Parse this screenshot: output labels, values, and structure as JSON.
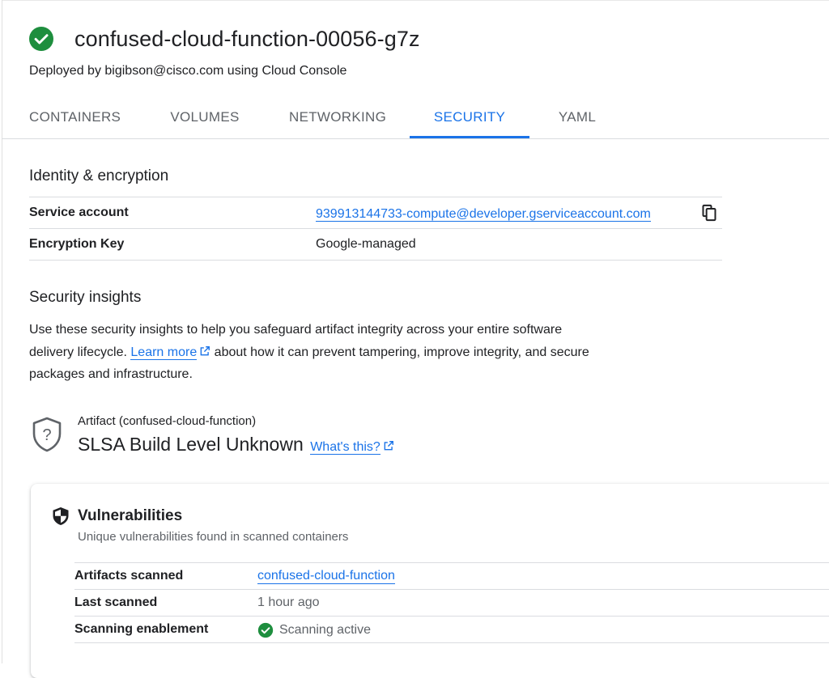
{
  "revision": {
    "name": "confused-cloud-function-00056-g7z",
    "status_icon": "check-circle-icon",
    "status_color": "#1e8e3e",
    "deployed_by": "Deployed by bigibson@cisco.com using Cloud Console"
  },
  "tabs": [
    {
      "label": "CONTAINERS",
      "active": false
    },
    {
      "label": "VOLUMES",
      "active": false
    },
    {
      "label": "NETWORKING",
      "active": false
    },
    {
      "label": "SECURITY",
      "active": true
    },
    {
      "label": "YAML",
      "active": false
    }
  ],
  "identity": {
    "title": "Identity & encryption",
    "rows": [
      {
        "key": "Service account",
        "value": "939913144733-compute@developer.gserviceaccount.com",
        "copy_icon": "copy-icon"
      },
      {
        "key": "Encryption Key",
        "value": "Google-managed"
      }
    ]
  },
  "insights": {
    "title": "Security insights",
    "text_before": "Use these security insights to help you safeguard artifact integrity across your entire software delivery lifecycle.",
    "link_label": "Learn more",
    "text_after": "about how it can prevent tampering, improve integrity, and secure packages and infrastructure."
  },
  "artifact": {
    "label": "Artifact (confused-cloud-function)",
    "slsa_level": "SLSA Build Level Unknown",
    "whats_this": "What's this?",
    "icon": "shield-question-icon"
  },
  "vulnerabilities": {
    "title": "Vulnerabilities",
    "subtitle": "Unique vulnerabilities found in scanned containers",
    "icon": "shield-icon",
    "rows": [
      {
        "key": "Artifacts scanned",
        "value": "confused-cloud-function"
      },
      {
        "key": "Last scanned",
        "value": "1 hour ago"
      },
      {
        "key": "Scanning enablement",
        "value": "Scanning active"
      }
    ]
  },
  "colors": {
    "accent": "#1a73e8",
    "success": "#1e8e3e",
    "text": "#202124",
    "muted": "#5f6368",
    "divider": "#dadce0"
  }
}
